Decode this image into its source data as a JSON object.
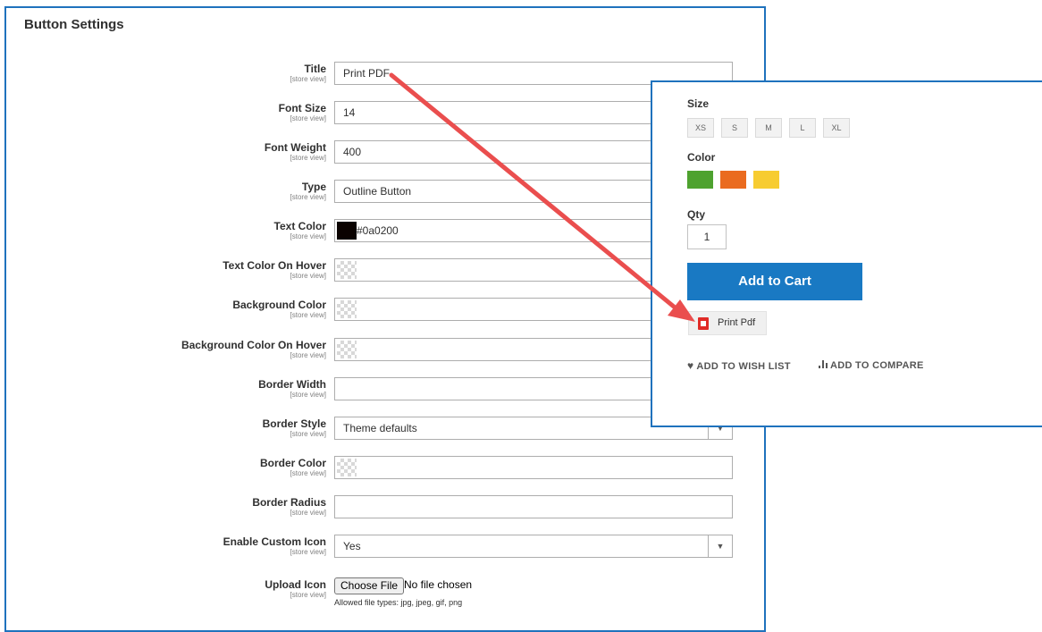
{
  "panel": {
    "title": "Button Settings"
  },
  "scope_label": "[store view]",
  "fields": {
    "title": {
      "label": "Title",
      "value": "Print PDF"
    },
    "font_size": {
      "label": "Font Size",
      "value": "14"
    },
    "font_weight": {
      "label": "Font Weight",
      "value": "400"
    },
    "type": {
      "label": "Type",
      "value": "Outline Button"
    },
    "text_color": {
      "label": "Text Color",
      "value": "#0a0200"
    },
    "text_color_hover": {
      "label": "Text Color On Hover"
    },
    "background_color": {
      "label": "Background Color"
    },
    "background_color_hover": {
      "label": "Background Color On Hover"
    },
    "border_width": {
      "label": "Border Width",
      "value": ""
    },
    "border_style": {
      "label": "Border Style",
      "value": "Theme defaults"
    },
    "border_color": {
      "label": "Border Color"
    },
    "border_radius": {
      "label": "Border Radius",
      "value": ""
    },
    "enable_custom_icon": {
      "label": "Enable Custom Icon",
      "value": "Yes"
    },
    "upload_icon": {
      "label": "Upload Icon",
      "button": "Choose File",
      "status": "No file chosen",
      "note": "Allowed file types: jpg, jpeg, gif, png"
    }
  },
  "product": {
    "size_label": "Size",
    "sizes": [
      "XS",
      "S",
      "M",
      "L",
      "XL"
    ],
    "color_label": "Color",
    "colors": [
      "#4ea22f",
      "#ea6b1f",
      "#f7cc31"
    ],
    "qty_label": "Qty",
    "qty_value": "1",
    "add_to_cart": "Add to Cart",
    "print_pdf": "Print Pdf",
    "wishlist": "ADD TO WISH LIST",
    "compare": "ADD TO COMPARE"
  },
  "colors": {
    "accent_border": "#1f72bd",
    "primary_button": "#1979c3",
    "annotation_arrow": "#ea4e4e",
    "text_color_swatch": "#0a0200"
  }
}
